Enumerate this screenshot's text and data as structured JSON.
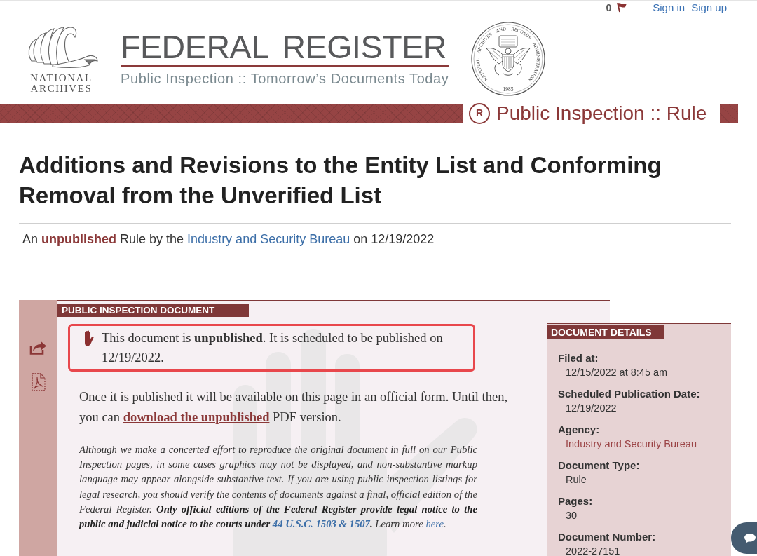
{
  "top_bar": {
    "count": "0",
    "links": [
      {
        "label": "Sign in"
      },
      {
        "label": "Sign up"
      }
    ]
  },
  "header": {
    "logo_text": "NATIONAL ARCHIVES",
    "title": "FEDERAL REGISTER",
    "tagline": "Public Inspection :: Tomorrow’s Documents Today",
    "seal": {
      "ring_text": "NATIONAL ARCHIVES AND RECORDS ADMINISTRATION",
      "year": "1985"
    }
  },
  "banner": {
    "badge": "R",
    "label": "Public Inspection :: Rule"
  },
  "document": {
    "title": "Additions and Revisions to the Entity List and Conforming Removal from the Unverified List",
    "byline": [
      {
        "kind": "text",
        "text": "An **unpublished** Rule by the "
      },
      {
        "kind": "link",
        "text": "Industry and Security Bureau",
        "bold": false
      },
      {
        "kind": "text",
        "text": " on 12/19/2022"
      }
    ]
  },
  "inspection_panel": {
    "tab": "PUBLIC INSPECTION DOCUMENT",
    "notice": "This document is **unpublished**. It is scheduled to be published on 12/19/2022.",
    "availability": [
      {
        "kind": "text",
        "text": "Once it is published it will be available on this page in an official form. Until then, you can "
      },
      {
        "kind": "link",
        "text": "download the unpublished",
        "bold": true
      },
      {
        "kind": "text",
        "text": " PDF version."
      }
    ],
    "disclaimer": [
      {
        "kind": "text",
        "text": "Although we make a concerted effort to reproduce the original document in full on our Public Inspection pages, in some cases graphics may not be displayed, and non-substantive markup language may appear alongside substantive text. If you are using public inspection listings for legal research, you should verify the contents of documents against a final, official edition of the Federal Register. **Only official editions of the Federal Register provide legal notice to the public and judicial notice to the courts under** "
      },
      {
        "kind": "link",
        "text": "44 U.S.C. 1503 & 1507",
        "bold": true
      },
      {
        "kind": "text",
        "text": "**.** Learn more "
      },
      {
        "kind": "link",
        "text": "here",
        "bold": false
      },
      {
        "kind": "text",
        "text": "."
      }
    ]
  },
  "details": {
    "heading": "DOCUMENT DETAILS",
    "items": [
      {
        "label": "Filed at:",
        "value": "12/15/2022 at 8:45 am",
        "kind": "text"
      },
      {
        "label": "Scheduled Publication Date:",
        "value": "12/19/2022",
        "kind": "text"
      },
      {
        "label": "Agency:",
        "value": "Industry and Security Bureau",
        "kind": "link"
      },
      {
        "label": "Document Type:",
        "value": "Rule",
        "kind": "text"
      },
      {
        "label": "Pages:",
        "value": "30",
        "kind": "text"
      },
      {
        "label": "Document Number:",
        "value": "2022-27151",
        "kind": "text"
      }
    ]
  }
}
